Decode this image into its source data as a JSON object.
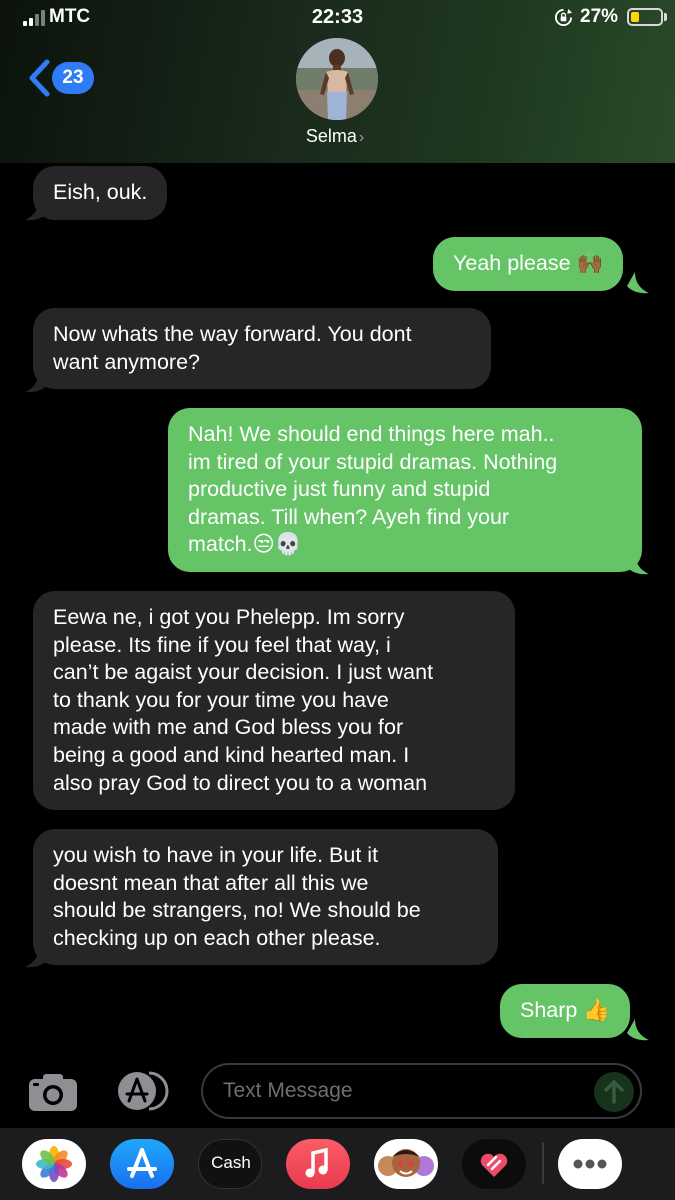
{
  "status_bar": {
    "carrier": "MTC",
    "time": "22:33",
    "battery_percent": "27%",
    "battery_level": 0.27
  },
  "header": {
    "back_count": "23",
    "contact_name": "Selma",
    "name_chevron": "›"
  },
  "messages": [
    {
      "from": "them",
      "text": "Eish, ouk."
    },
    {
      "from": "me",
      "text": "Yeah please 🙌🏾"
    },
    {
      "from": "them",
      "text": "Now whats the way forward. You dont\nwant anymore?"
    },
    {
      "from": "me",
      "text": "Nah! We should end things here mah..\nim tired of your stupid dramas. Nothing\nproductive just funny and stupid\ndramas. Till when? Ayeh find your\nmatch.😒💀"
    },
    {
      "from": "them",
      "text": "Eewa ne, i got you Phelepp. Im sorry\nplease. Its fine if you feel that way, i\ncan’t be agaist your decision. I just want\nto thank you for your time you have\nmade with me and God bless you for\nbeing a good and kind hearted man. I\nalso pray God to direct you to a woman"
    },
    {
      "from": "them",
      "text": "you wish to have in your life. But it\ndoesnt mean that after all this we\nshould be strangers, no! We should be\nchecking up on each other please."
    },
    {
      "from": "me",
      "text": "Sharp 👍"
    }
  ],
  "input": {
    "placeholder": "Text Message"
  },
  "app_drawer": {
    "apps": [
      "photos-icon",
      "app-store-icon",
      "apple-cash-icon",
      "music-icon",
      "memoji-icon",
      "digital-touch-icon",
      "more-icon"
    ],
    "cash_label": "Cash",
    "cash_apple_glyph": ""
  },
  "colors": {
    "incoming_bubble": "#262629",
    "outgoing_bubble": "#65c466",
    "badge_blue": "#2f7cf6",
    "battery_yellow": "#ffd60a"
  }
}
